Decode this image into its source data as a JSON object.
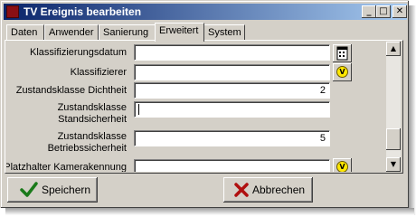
{
  "window": {
    "title": "TV Ereignis bearbeiten"
  },
  "titlebar_buttons": {
    "minimize": "_",
    "maximize": "□",
    "close": "✕"
  },
  "tabs": [
    {
      "label": "Daten"
    },
    {
      "label": "Anwender"
    },
    {
      "label": "Sanierung"
    },
    {
      "label": "Erweitert",
      "active": true
    },
    {
      "label": "System"
    }
  ],
  "form": {
    "rows": [
      {
        "label": "Klassifizierungsdatum",
        "value": ""
      },
      {
        "label": "Klassifizierer",
        "value": ""
      },
      {
        "label": "Zustandsklasse Dichtheit",
        "value": "2"
      },
      {
        "label_line1": "Zustandsklasse",
        "label_line2": "Standsicherheit",
        "value": ""
      },
      {
        "label_line1": "Zustandsklasse",
        "label_line2": "Betriebssicherheit",
        "value": "5"
      },
      {
        "label": "Platzhalter Kamerakennung",
        "value": ""
      }
    ],
    "calendar_icon": "calendar-icon",
    "lookup_icon_text": "V"
  },
  "scrollbar": {
    "up": "▲",
    "down": "▼"
  },
  "buttons": {
    "save": "Speichern",
    "cancel": "Abbrechen"
  },
  "colors": {
    "title_start": "#0a246a",
    "title_end": "#a6caf0",
    "save_check": "#1a7a1a",
    "cancel_x": "#b01010",
    "lookup": "#ffe800"
  }
}
